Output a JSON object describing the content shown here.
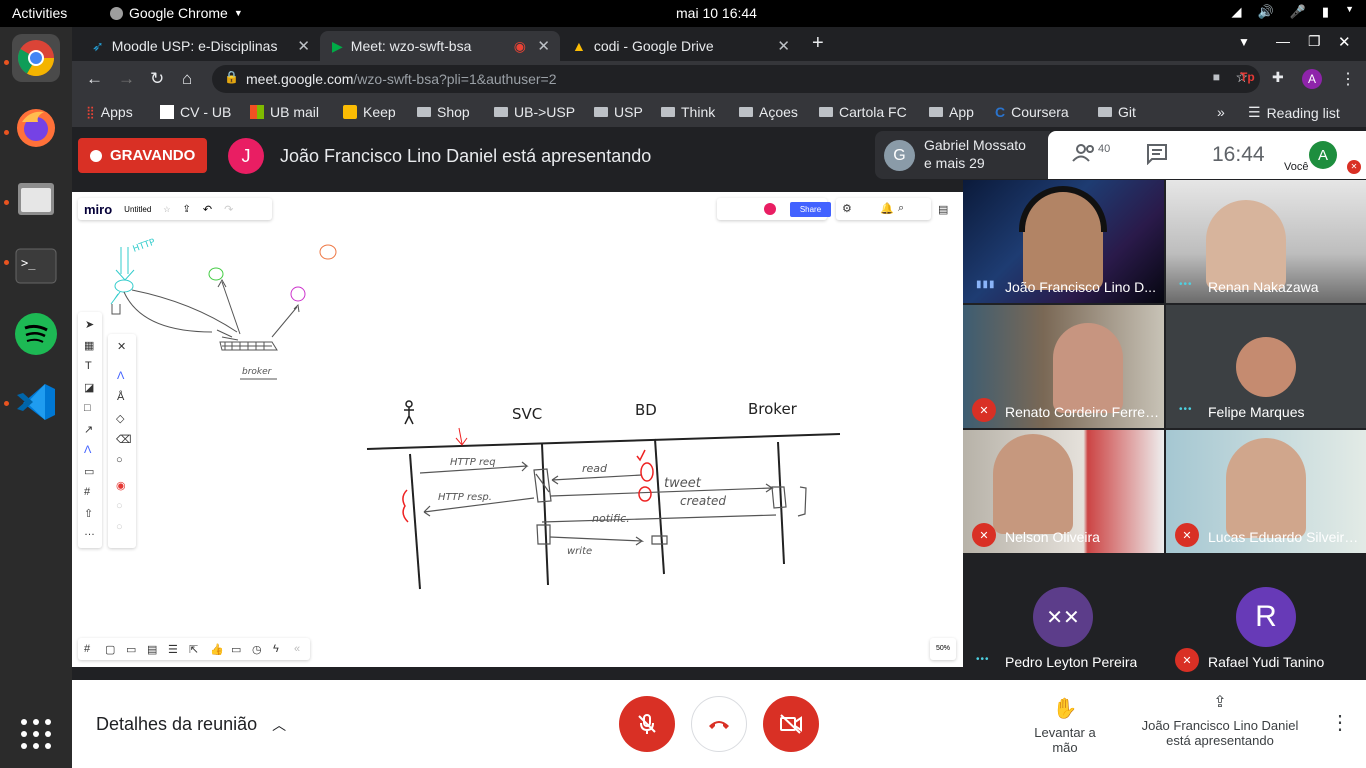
{
  "os": {
    "activities": "Activities",
    "app_name": "Google Chrome",
    "clock": "mai 10  16:44"
  },
  "browser": {
    "tabs": [
      {
        "label": "Moodle USP: e-Disciplinas"
      },
      {
        "label": "Meet: wzo-swft-bsa"
      },
      {
        "label": "codi - Google Drive"
      }
    ],
    "url_host": "meet.google.com",
    "url_path": "/wzo-swft-bsa?pli=1&authuser=2",
    "profile_initial": "A",
    "bookmarks": [
      "Apps",
      "CV - UB",
      "UB mail",
      "Keep",
      "Shop",
      "UB->USP",
      "USP",
      "Think",
      "Açoes",
      "Cartola FC",
      "App",
      "Coursera",
      "Git"
    ],
    "reading_list": "Reading list"
  },
  "meet": {
    "recording_label": "GRAVANDO",
    "presenter_initial": "J",
    "presenter_text": "João Francisco Lino Daniel está apresentando",
    "other_name": "Gabriel Mossato",
    "other_more": "e mais 29",
    "other_initial": "G",
    "people_count": "40",
    "time": "16:44",
    "you_label": "Você",
    "you_initial": "A",
    "participants": [
      {
        "name": "João Francisco Lino D..."
      },
      {
        "name": "Renan Nakazawa"
      },
      {
        "name": "Renato Cordeiro Ferreira"
      },
      {
        "name": "Felipe Marques"
      },
      {
        "name": "Nelson Oliveira"
      },
      {
        "name": "Lucas Eduardo Silveira..."
      },
      {
        "name": "Pedro Leyton Pereira"
      },
      {
        "name": "Rafael Yudi Tanino",
        "initial": "R"
      }
    ],
    "details_label": "Detalhes da reunião",
    "raise_hand_label": "Levantar a mão",
    "presenting_label_1": "João Francisco Lino Daniel",
    "presenting_label_2": "está apresentando"
  },
  "miro": {
    "logo": "miro",
    "board_title": "Untitled",
    "share_label": "Share",
    "zoom": "50%",
    "sketch_labels": {
      "http": "HTTP",
      "broker_small": "broker",
      "svc": "SVC",
      "bd": "BD",
      "broker": "Broker",
      "http_req": "HTTP req",
      "http_resp": "HTTP resp.",
      "read": "read",
      "tweet": "tweet",
      "created": "created",
      "notific": "notific.",
      "write": "write"
    }
  }
}
